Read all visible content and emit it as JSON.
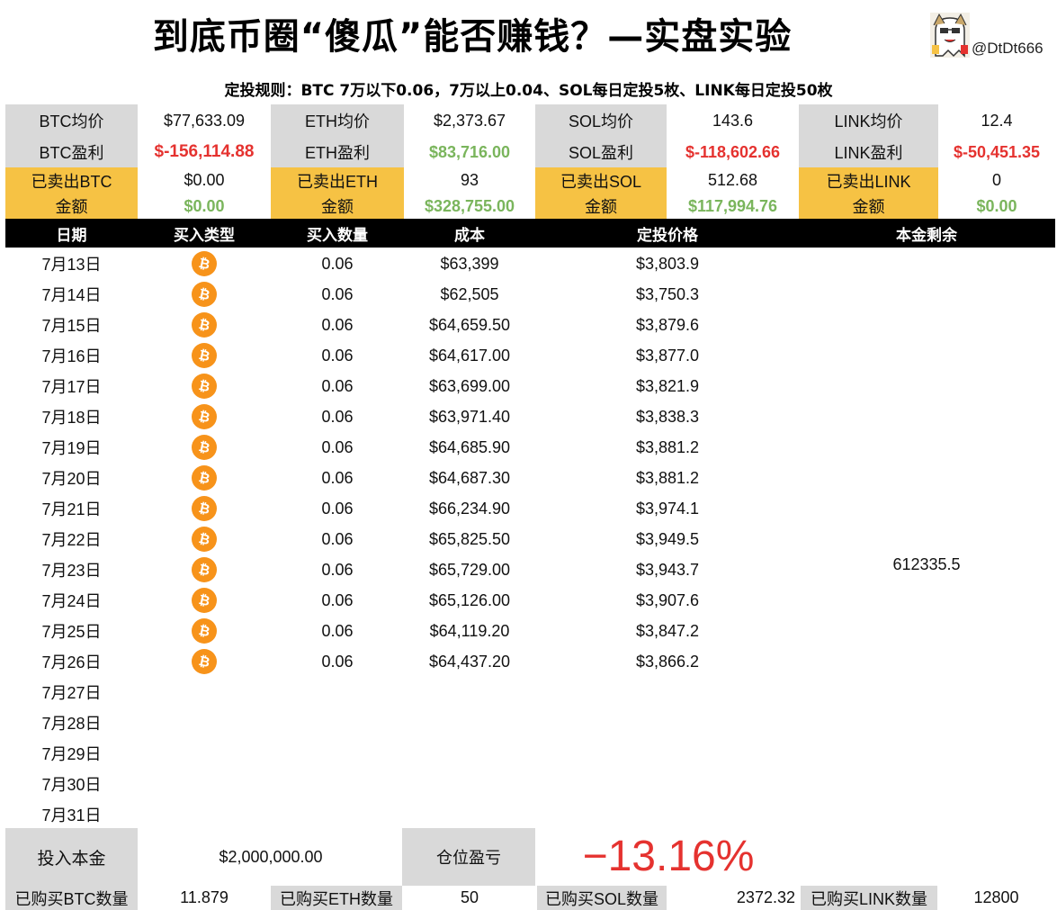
{
  "title": "到底币圈“傻瓜”能否赚钱？—实盘实验",
  "handle": "@DtDt666",
  "rules": "定投规则：BTC 7万以下0.06，7万以上0.04、SOL每日定投5枚、LINK每日定投50枚",
  "summary": {
    "row1": [
      "BTC均价",
      "$77,633.09",
      "ETH均价",
      "$2,373.67",
      "SOL均价",
      "143.6",
      "LINK均价",
      "12.4"
    ],
    "row2": [
      "BTC盈利",
      "$-156,114.88",
      "ETH盈利",
      "$83,716.00",
      "SOL盈利",
      "$-118,602.66",
      "LINK盈利",
      "$-50,451.35"
    ],
    "row3": [
      "已卖出BTC",
      "$0.00",
      "已卖出ETH",
      "93",
      "已卖出SOL",
      "512.68",
      "已卖出LINK",
      "0"
    ],
    "row4": [
      "金额",
      "$0.00",
      "金额",
      "$328,755.00",
      "金额",
      "$117,994.76",
      "金额",
      "$0.00"
    ]
  },
  "table": {
    "headers": [
      "日期",
      "买入类型",
      "买入数量",
      "成本",
      "定投价格",
      "本金剩余"
    ],
    "rows": [
      {
        "date": "7月13日",
        "qty": "0.06",
        "cost": "$63,399",
        "price": "$3,803.9"
      },
      {
        "date": "7月14日",
        "qty": "0.06",
        "cost": "$62,505",
        "price": "$3,750.3"
      },
      {
        "date": "7月15日",
        "qty": "0.06",
        "cost": "$64,659.50",
        "price": "$3,879.6"
      },
      {
        "date": "7月16日",
        "qty": "0.06",
        "cost": "$64,617.00",
        "price": "$3,877.0"
      },
      {
        "date": "7月17日",
        "qty": "0.06",
        "cost": "$63,699.00",
        "price": "$3,821.9"
      },
      {
        "date": "7月18日",
        "qty": "0.06",
        "cost": "$63,971.40",
        "price": "$3,838.3"
      },
      {
        "date": "7月19日",
        "qty": "0.06",
        "cost": "$64,685.90",
        "price": "$3,881.2"
      },
      {
        "date": "7月20日",
        "qty": "0.06",
        "cost": "$64,687.30",
        "price": "$3,881.2"
      },
      {
        "date": "7月21日",
        "qty": "0.06",
        "cost": "$66,234.90",
        "price": "$3,974.1"
      },
      {
        "date": "7月22日",
        "qty": "0.06",
        "cost": "$65,825.50",
        "price": "$3,949.5"
      },
      {
        "date": "7月23日",
        "qty": "0.06",
        "cost": "$65,729.00",
        "price": "$3,943.7"
      },
      {
        "date": "7月24日",
        "qty": "0.06",
        "cost": "$65,126.00",
        "price": "$3,907.6"
      },
      {
        "date": "7月25日",
        "qty": "0.06",
        "cost": "$64,119.20",
        "price": "$3,847.2"
      },
      {
        "date": "7月26日",
        "qty": "0.06",
        "cost": "$64,437.20",
        "price": "$3,866.2"
      },
      {
        "date": "7月27日",
        "qty": "",
        "cost": "",
        "price": ""
      },
      {
        "date": "7月28日",
        "qty": "",
        "cost": "",
        "price": ""
      },
      {
        "date": "7月29日",
        "qty": "",
        "cost": "",
        "price": ""
      },
      {
        "date": "7月30日",
        "qty": "",
        "cost": "",
        "price": ""
      },
      {
        "date": "7月31日",
        "qty": "",
        "cost": "",
        "price": ""
      }
    ],
    "buy_type_icon": "bitcoin-icon",
    "remaining_principal": "612335.5"
  },
  "footer": {
    "principal_label": "投入本金",
    "principal_value": "$2,000,000.00",
    "pnl_label": "仓位盈亏",
    "pnl_value": "−13.16%",
    "btc_qty_label": "已购买BTC数量",
    "btc_qty": "11.879",
    "eth_qty_label": "已购买ETH数量",
    "eth_qty": "50",
    "sol_qty_label": "已购买SOL数量",
    "sol_qty": "2372.32",
    "link_qty_label": "已购买LINK数量",
    "link_qty": "12800"
  },
  "colors": {
    "loss": "#e5322f",
    "profit": "#7ab55c",
    "label_gray": "#d9d9d9",
    "label_yellow": "#f6c244",
    "header_black": "#000000",
    "coin": "#f7931a"
  }
}
